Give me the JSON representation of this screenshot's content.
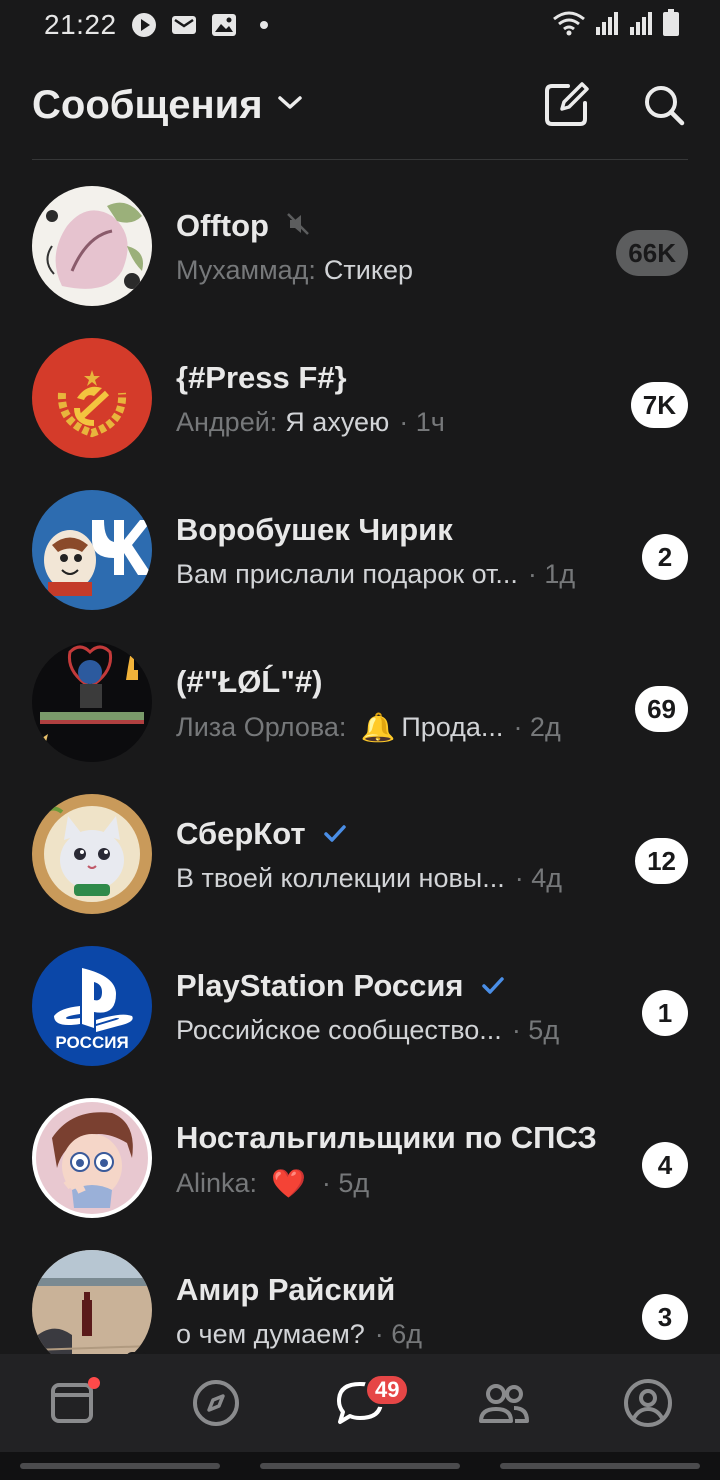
{
  "status_bar": {
    "time": "21:22",
    "left_icons": [
      "play-icon",
      "mail-icon",
      "image-icon",
      "dot-icon"
    ],
    "right_icons": [
      "wifi-icon",
      "signal-icon",
      "signal-icon",
      "battery-icon"
    ]
  },
  "header": {
    "title": "Сообщения",
    "dropdown_icon": "chevron-down-icon",
    "compose_icon": "compose-icon",
    "search_icon": "search-icon"
  },
  "chats": [
    {
      "name": "Offtop",
      "muted": true,
      "author": "Мухаммад:",
      "text": "Стикер",
      "time": "",
      "badge": "66K",
      "badge_muted": true
    },
    {
      "name": "{#Press F#}",
      "author": "Андрей:",
      "text": "Я ахуею",
      "time": "· 1ч",
      "badge": "7K"
    },
    {
      "name": "Воробушек Чирик",
      "author": "",
      "text": "Вам прислали подарок от...",
      "time": "· 1д",
      "badge": "2"
    },
    {
      "name": "(#\"ŁØĹ\"#)",
      "author": "Лиза Орлова:",
      "emoji": "🔔",
      "text": "Прода...",
      "time": "· 2д",
      "badge": "69"
    },
    {
      "name": "СберКот",
      "verified": true,
      "author": "",
      "text": "В твоей коллекции новы...",
      "time": "· 4д",
      "badge": "12"
    },
    {
      "name": "PlayStation Россия",
      "verified": true,
      "author": "",
      "text": "Российское сообщество...",
      "time": "· 5д",
      "badge": "1"
    },
    {
      "name": "Ностальгильщики по СПСЗ",
      "author": "Alinka:",
      "emoji": "❤️",
      "text": "",
      "time": "· 5д",
      "badge": "4"
    },
    {
      "name": "Амир Райский",
      "author": "",
      "text": "о чем думаем?",
      "time": "· 6д",
      "badge": "3"
    }
  ],
  "avatar_text": {
    "ps_caption": "РОССИЯ"
  },
  "bottom_nav": {
    "items": [
      "news-icon",
      "discover-icon",
      "messages-icon",
      "friends-icon",
      "profile-icon"
    ],
    "messages_badge": "49"
  },
  "colors": {
    "background": "#19191a",
    "badge_bg": "#ffffff",
    "badge_muted_bg": "#5c5d5e",
    "accent": "#4a8ee6",
    "notification": "#e64646"
  }
}
